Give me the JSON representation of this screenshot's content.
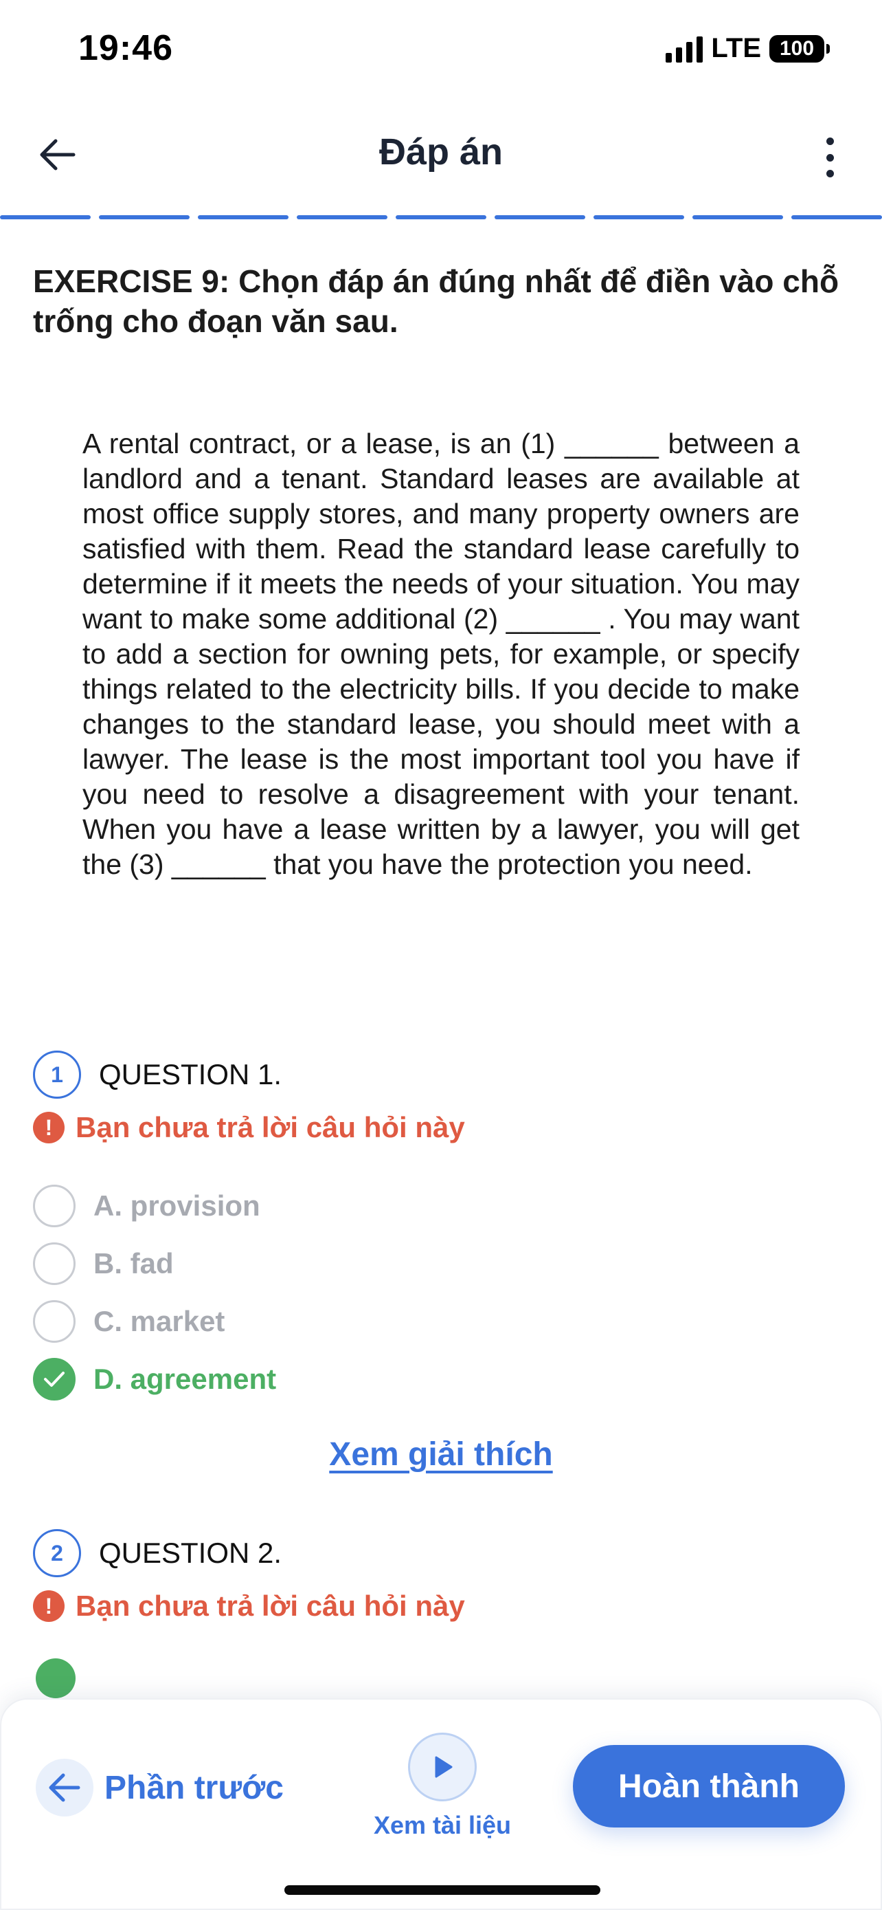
{
  "status_bar": {
    "time": "19:46",
    "network": "LTE",
    "battery": "100"
  },
  "header": {
    "title": "Đáp án"
  },
  "exercise": {
    "title": "EXERCISE 9: Chọn đáp án đúng nhất để điền vào chỗ trống cho đoạn văn sau.",
    "passage": "A rental contract, or a lease, is an (1) ______ between a landlord and a tenant. Standard leases are available at most office supply stores, and many property owners are satisfied with them. Read the standard lease carefully to determine if it meets the needs of your situation. You may want to make some additional (2) ______ . You may want to add a section for owning pets, for example, or specify things related to the electricity bills. If you decide to make changes to the standard lease, you should meet with a lawyer. The lease is the most important tool you have if you need to resolve a disagreement with your tenant. When you have a lease written by a lawyer, you will get the (3) ______ that you have the protection you need."
  },
  "questions": [
    {
      "number": "1",
      "label": "QUESTION 1.",
      "warning": "Bạn chưa trả lời câu hỏi này",
      "options": [
        {
          "text": "A. provision",
          "correct": false
        },
        {
          "text": "B. fad",
          "correct": false
        },
        {
          "text": "C. market",
          "correct": false
        },
        {
          "text": "D. agreement",
          "correct": true
        }
      ],
      "explain_link": "Xem giải thích"
    },
    {
      "number": "2",
      "label": "QUESTION 2.",
      "warning": "Bạn chưa trả lời câu hỏi này"
    }
  ],
  "bottom_bar": {
    "prev_label": "Phần trước",
    "docs_label": "Xem tài liệu",
    "finish_label": "Hoàn thành"
  },
  "colors": {
    "accent": "#3a73dc",
    "warning": "#df5a42",
    "correct": "#4caf63",
    "muted": "#a7aab1"
  }
}
